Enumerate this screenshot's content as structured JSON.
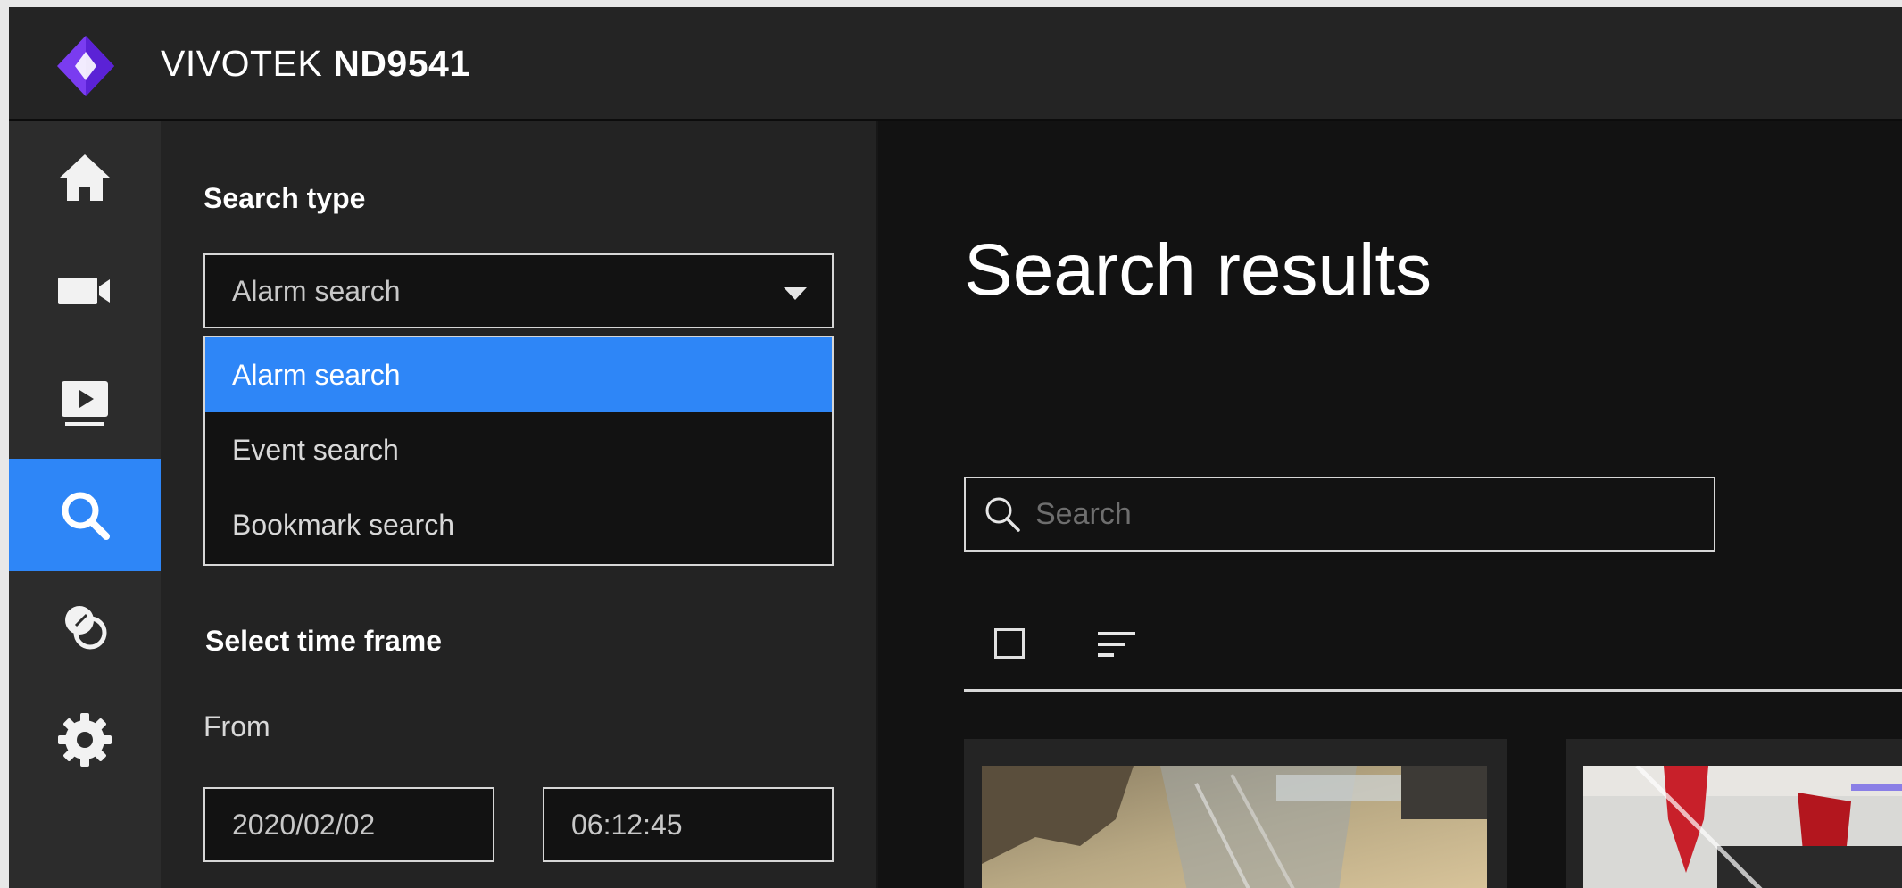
{
  "header": {
    "brand": "VIVOTEK",
    "model": "ND9541",
    "logo_icon": "vivotek-diamond-logo",
    "logo_color": "#7a3cf0"
  },
  "sidebar": {
    "items": [
      {
        "id": "home",
        "icon": "home-icon",
        "active": false
      },
      {
        "id": "live-view",
        "icon": "camera-icon",
        "active": false
      },
      {
        "id": "playback",
        "icon": "playback-icon",
        "active": false
      },
      {
        "id": "search",
        "icon": "search-icon",
        "active": true
      },
      {
        "id": "vca",
        "icon": "overlap-circles-icon",
        "active": false
      },
      {
        "id": "settings",
        "icon": "gear-icon",
        "active": false
      }
    ]
  },
  "panel": {
    "search_type_title": "Search type",
    "search_type_value": "Alarm search",
    "dropdown_options": [
      "Alarm search",
      "Event search",
      "Bookmark search"
    ],
    "selected_option_index": 0,
    "time_frame_title": "Select time frame",
    "from_label": "From",
    "from_date": "2020/02/02",
    "from_time": "06:12:45"
  },
  "main": {
    "title": "Search results",
    "search_placeholder": "Search",
    "select_all_icon": "checkbox-icon",
    "sort_icon": "sort-icon"
  },
  "colors": {
    "accent": "#2e86f7",
    "background": "#121212",
    "panel": "#232323",
    "sidebar": "#2c2c2c",
    "topbar": "#242424"
  }
}
